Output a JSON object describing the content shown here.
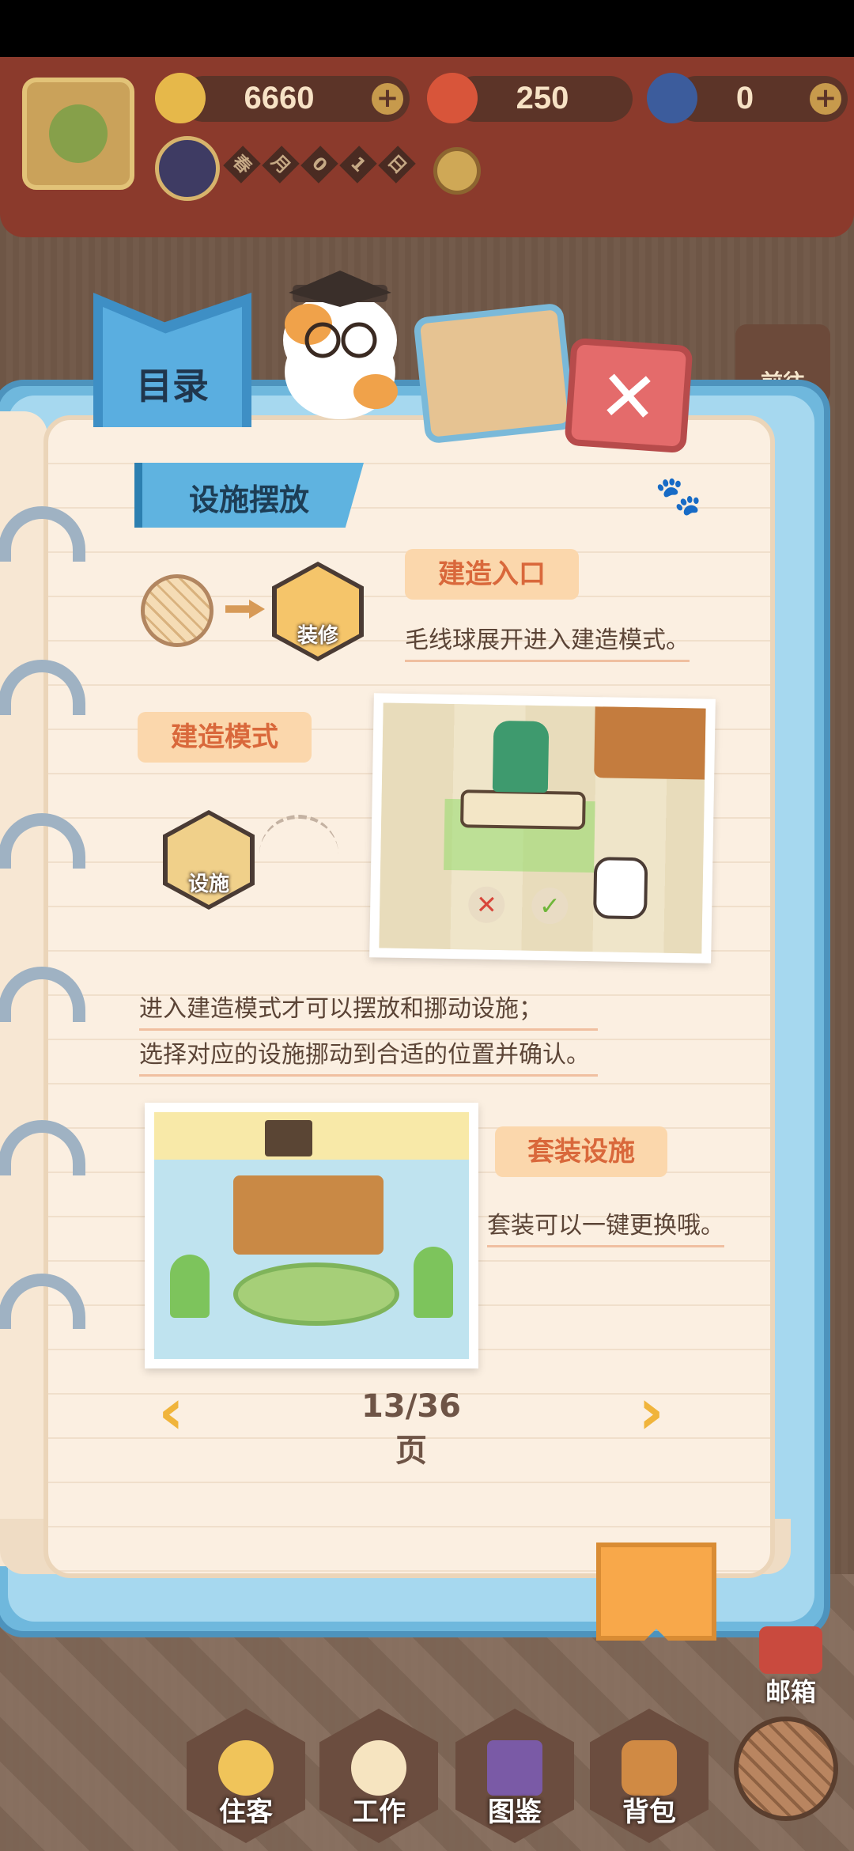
{
  "top_bar": {
    "resources": [
      {
        "name": "banana-icon",
        "value": "6660"
      },
      {
        "name": "chili-icon",
        "value": "250"
      },
      {
        "name": "blue-banana-icon",
        "value": "0"
      }
    ],
    "plus": "+",
    "date": [
      "春",
      "月",
      "0",
      "1",
      "日"
    ]
  },
  "book": {
    "tab_label": "目录",
    "section_title": "设施摆放",
    "entry_pill": "建造入口",
    "hex_decorate_label": "装修",
    "entry_desc": "毛线球展开进入建造模式。",
    "mode_pill": "建造模式",
    "hex_facility_label": "设施",
    "mode_desc_1": "进入建造模式才可以摆放和挪动设施；",
    "mode_desc_2": "选择对应的设施挪动到合适的位置并确认。",
    "set_pill": "套装设施",
    "set_desc": "套装可以一键更换哦。",
    "pager": {
      "prev": "‹",
      "label": "13/36页",
      "next": "›"
    },
    "close": "✕"
  },
  "side": {
    "mail_side_label": "前往",
    "mailbox_label": "邮箱"
  },
  "nav": [
    {
      "name": "nav-tenant",
      "label": "住客"
    },
    {
      "name": "nav-work",
      "label": "工作"
    },
    {
      "name": "nav-guide",
      "label": "图鉴"
    },
    {
      "name": "nav-bag",
      "label": "背包"
    }
  ]
}
